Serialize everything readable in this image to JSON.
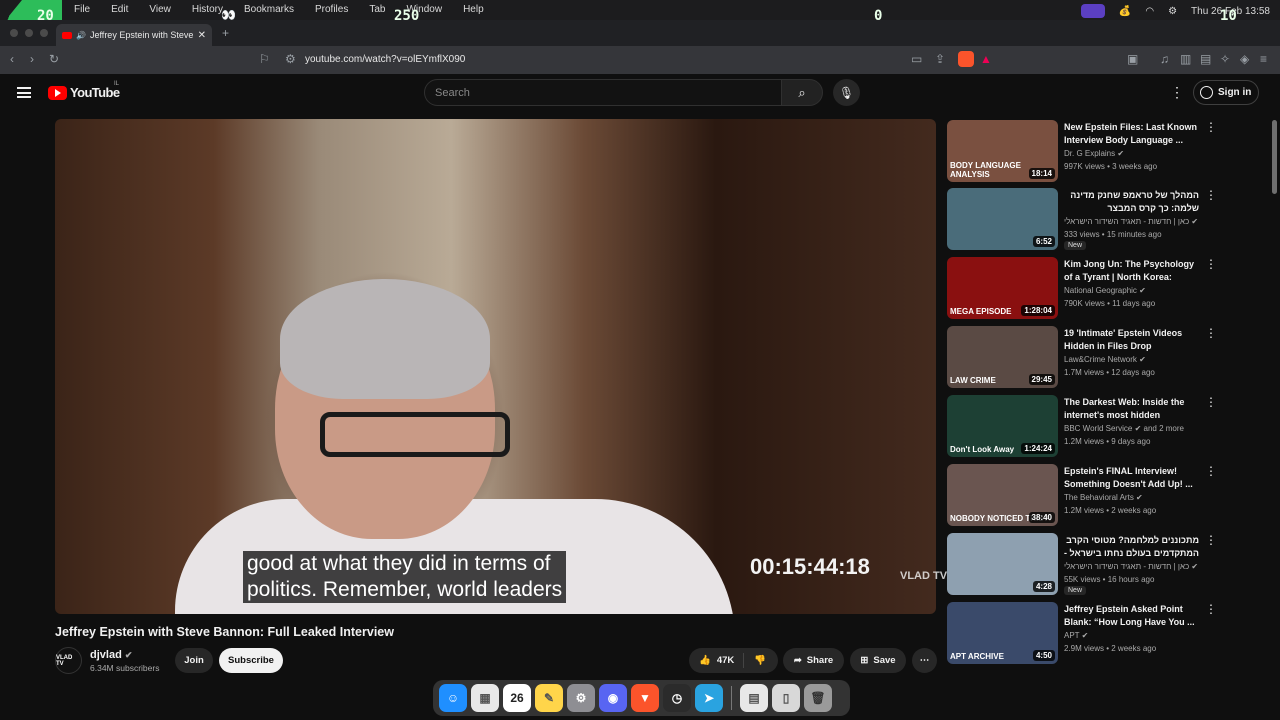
{
  "menubar": {
    "items": [
      "File",
      "Edit",
      "View",
      "History",
      "Bookmarks",
      "Profiles",
      "Tab",
      "Window",
      "Help"
    ],
    "hud": [
      "20",
      "250",
      "0",
      "10"
    ],
    "clock": "Thu 26 Feb  13:58"
  },
  "tab": {
    "title": "Jeffrey Epstein with Steve B"
  },
  "address": {
    "url": "youtube.com/watch?v=olEYmflX090",
    "brave_count": "40"
  },
  "yt": {
    "logo": "YouTube",
    "country": "IL",
    "search_placeholder": "Search",
    "signin": "Sign in"
  },
  "video": {
    "subtitle_line1": "good at what they did in terms of",
    "subtitle_line2": "politics. Remember, world leaders",
    "timecode": "00:15:44:18",
    "watermark": "VLAD TV",
    "title": "Jeffrey Epstein with Steve Bannon: Full Leaked Interview",
    "channel": "djvlad",
    "subscribers": "6.34M subscribers",
    "join": "Join",
    "subscribe": "Subscribe",
    "likes": "47K",
    "share": "Share",
    "save": "Save"
  },
  "recommendations": [
    {
      "title": "New Epstein Files: Last Known Interview Body Language ...",
      "channel": "Dr. G Explains",
      "meta": "997K views • 3 weeks ago",
      "duration": "18:14",
      "thumb_label": "BODY LANGUAGE ANALYSIS",
      "color": "#7a5040"
    },
    {
      "title": "המהלך של טראמפ שחנק מדינה שלמה: כך קרס המבצר הקומוניסטי ...",
      "channel": "כאן | חדשות - תאגיד השידור הישראלי",
      "meta": "333 views • 15 minutes ago",
      "duration": "6:52",
      "badge": "New",
      "color": "#4a6c7a",
      "rtl": true
    },
    {
      "title": "Kim Jong Un: The Psychology of a Tyrant | North Korea: Insid...",
      "channel": "National Geographic",
      "meta": "790K views • 11 days ago",
      "duration": "1:28:04",
      "thumb_label": "MEGA EPISODE",
      "color": "#8a1010"
    },
    {
      "title": "19 'Intimate' Epstein Videos Hidden in Files Drop",
      "channel": "Law&Crime Network",
      "meta": "1.7M views • 12 days ago",
      "duration": "29:45",
      "thumb_label": "LAW CRIME",
      "color": "#5a4a44"
    },
    {
      "title": "The Darkest Web: Inside the internet's most hidden corners...",
      "channel": "BBC World Service",
      "channel_extra": "and 2 more",
      "meta": "1.2M views • 9 days ago",
      "duration": "1:24:24",
      "thumb_label": "Don't Look Away",
      "color": "#1d4034"
    },
    {
      "title": "Epstein's FINAL Interview! Something Doesn't Add Up! ...",
      "channel": "The Behavioral Arts",
      "meta": "1.2M views • 2 weeks ago",
      "duration": "38:40",
      "thumb_label": "NOBODY NOTICED THIS?!",
      "color": "#6a5550"
    },
    {
      "title": "מתכוננים למלחמה? מטוסי הקרב המתקדמים בעולם נחתו בישראל - ...",
      "channel": "כאן | חדשות - תאגיד השידור הישראלי",
      "meta": "55K views • 16 hours ago",
      "duration": "4:28",
      "badge": "New",
      "color": "#8ea0b0",
      "rtl": true
    },
    {
      "title": "Jeffrey Epstein Asked Point Blank: “How Long Have You ...",
      "channel": "APT",
      "meta": "2.9M views • 2 weeks ago",
      "duration": "4:50",
      "thumb_label": "APT ARCHIVE",
      "color": "#3a4a6a"
    }
  ],
  "dock": {
    "calendar_day": "26",
    "apps": [
      "finder-icon",
      "launchpad-icon",
      "calendar-icon",
      "notes-icon",
      "settings-icon",
      "discord-icon",
      "brave-icon",
      "clock-icon",
      "telegram-icon",
      "window-icon",
      "file-icon",
      "trash-icon"
    ]
  },
  "colors": {
    "accent": "#ff0000",
    "bg": "#0f0f0f",
    "hud_green": "#2dbd5a"
  }
}
